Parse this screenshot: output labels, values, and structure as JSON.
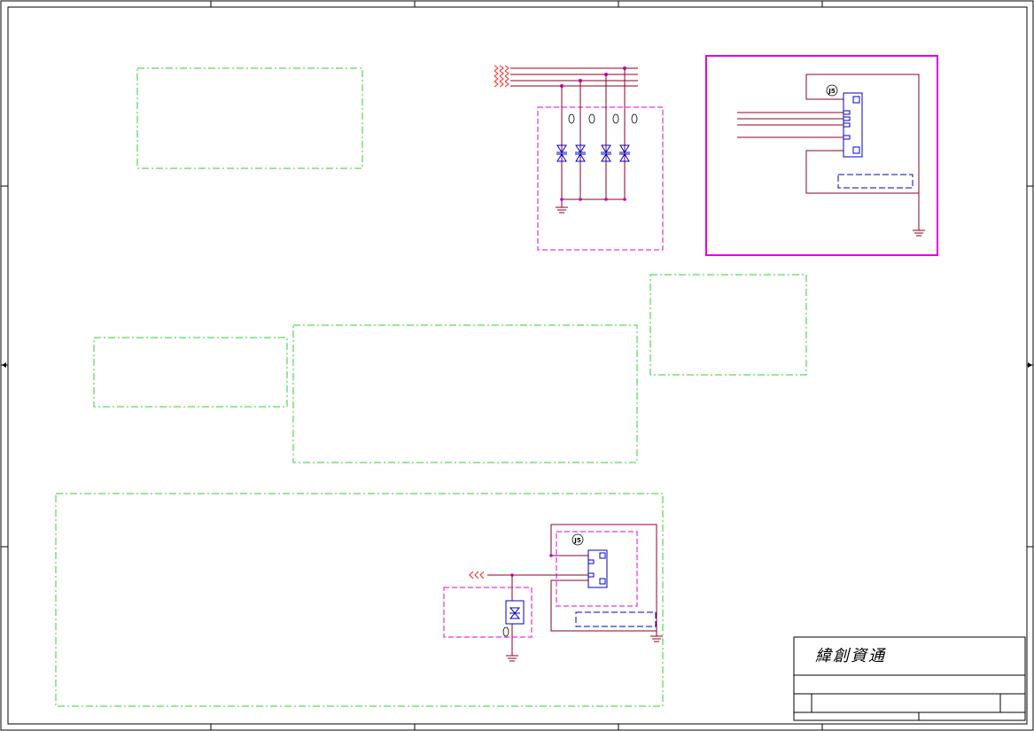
{
  "sheet": {
    "title_block": {
      "company": "緯創資通"
    }
  },
  "colors": {
    "border": "#000000",
    "net_wire": "#8b0026",
    "net_red": "#ff2020",
    "component": "#0000cc",
    "group_magenta": "#e000e0",
    "section_green": "#33cc33",
    "ground": "#8b0026"
  },
  "components": {
    "connector_top_right": {
      "icon": "circled-j-marker",
      "ref": "J5"
    },
    "connector_bottom": {
      "icon": "circled-j-marker",
      "ref": "J5"
    },
    "diode_array_top": {
      "icon": "zener-diode",
      "count": 4,
      "refs": [
        "D",
        "D",
        "D",
        "D"
      ]
    },
    "diode_bottom": {
      "icon": "tvs-diode",
      "ref": "D"
    }
  }
}
